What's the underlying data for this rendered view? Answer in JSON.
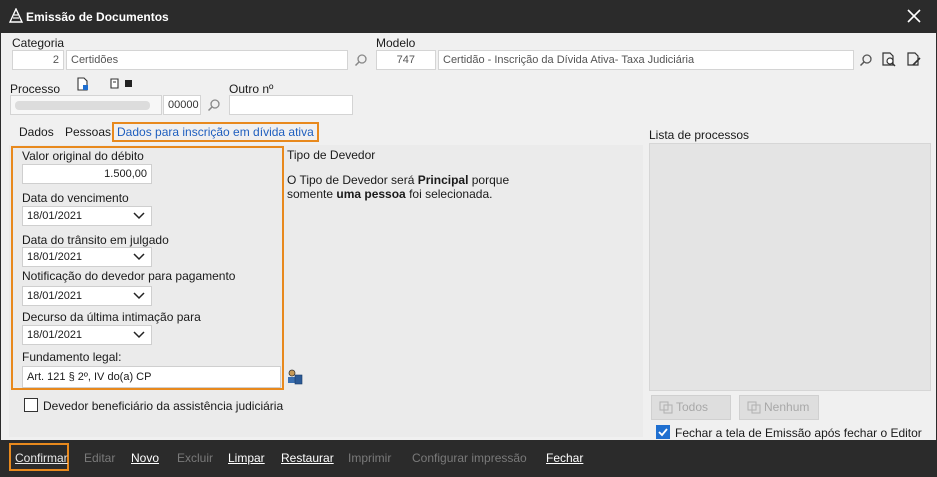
{
  "window": {
    "title": "Emissão de Documentos"
  },
  "header": {
    "categoria_label": "Categoria",
    "categoria_code": "2",
    "categoria_value": "Certidões",
    "modelo_label": "Modelo",
    "modelo_code": "747",
    "modelo_value": "Certidão - Inscrição da Dívida Ativa- Taxa Judiciária",
    "processo_label": "Processo",
    "processo_suffix": "00000",
    "outro_label": "Outro nº",
    "outro_value": ""
  },
  "tabs": [
    {
      "label": "Dados"
    },
    {
      "label": "Pessoas"
    },
    {
      "label": "Dados para inscrição em dívida ativa"
    }
  ],
  "form": {
    "valor_label": "Valor original do débito",
    "valor_value": "1.500,00",
    "vencimento_label": "Data do vencimento",
    "vencimento_value": "18/01/2021",
    "transito_label": "Data do trânsito em julgado",
    "transito_value": "18/01/2021",
    "notificacao_label": "Notificação do devedor para pagamento",
    "notificacao_value": "18/01/2021",
    "decurso_label": "Decurso da última intimação para",
    "decurso_value": "18/01/2021",
    "fundamento_label": "Fundamento legal:",
    "fundamento_value": "Art. 121 § 2º, IV do(a) CP",
    "beneficiario_label": "Devedor beneficiário da assistência judiciária"
  },
  "tipo_devedor": {
    "title": "Tipo de Devedor",
    "line1_a": "O Tipo de Devedor será ",
    "line1_b": "Principal",
    "line1_c": " porque",
    "line2_a": "somente ",
    "line2_b": "uma pessoa",
    "line2_c": " foi selecionada."
  },
  "processos": {
    "title": "Lista de processos",
    "todos_label": "Todos",
    "nenhum_label": "Nenhum",
    "fechar_label": "Fechar a tela de Emissão após fechar o Editor"
  },
  "toolbar": {
    "confirmar": "Confirmar",
    "editar": "Editar",
    "novo": "Novo",
    "excluir": "Excluir",
    "limpar": "Limpar",
    "restaurar": "Restaurar",
    "imprimir": "Imprimir",
    "configurar": "Configurar impressão",
    "fechar": "Fechar"
  },
  "colors": {
    "accent_orange": "#e8891d",
    "active_tab_blue": "#1f5fbf",
    "titlebar": "#2b2b2b"
  }
}
